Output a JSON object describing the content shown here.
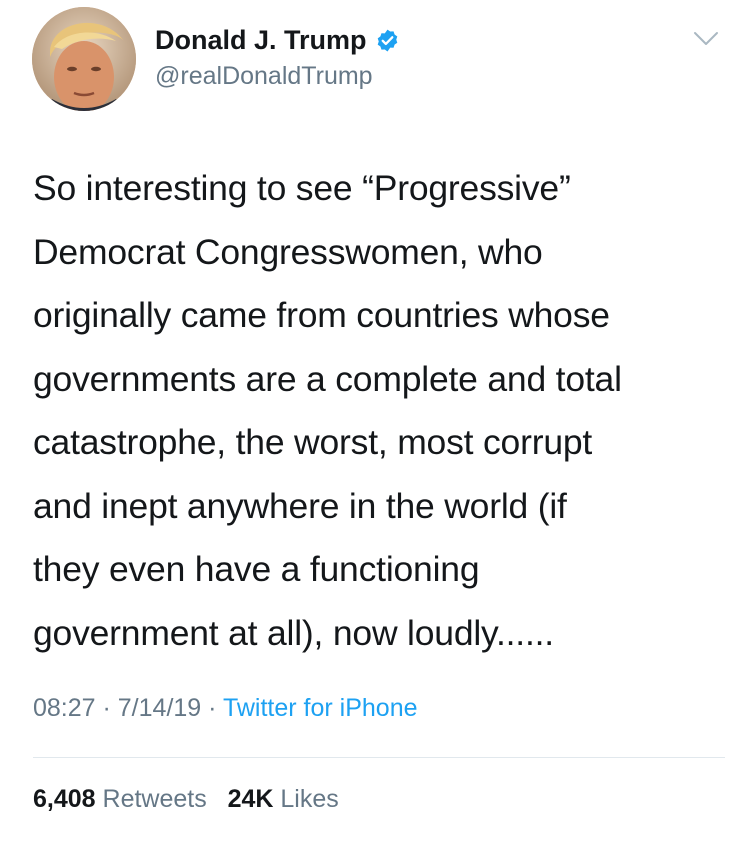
{
  "author": {
    "display_name": "Donald J. Trump",
    "handle": "@realDonaldTrump",
    "verified": true,
    "avatar_icon": "profile-photo"
  },
  "tweet": {
    "lines": [
      "So interesting to see “Progressive”",
      "Democrat Congresswomen, who",
      "originally came from countries whose",
      "governments are a complete and total",
      "catastrophe, the worst, most corrupt",
      "and inept anywhere in the world (if",
      "they even have a functioning",
      "government at all), now loudly......"
    ]
  },
  "meta": {
    "time": "08:27",
    "sep1": " · ",
    "date": "7/14/19",
    "sep2": " · ",
    "source": "Twitter for iPhone"
  },
  "stats": {
    "retweets_count": "6,408",
    "retweets_label": "Retweets",
    "likes_count": "24K",
    "likes_label": "Likes"
  },
  "colors": {
    "accent": "#1da1f2",
    "text": "#14171a",
    "secondary_text": "#657786",
    "divider": "#e1e8ed"
  }
}
